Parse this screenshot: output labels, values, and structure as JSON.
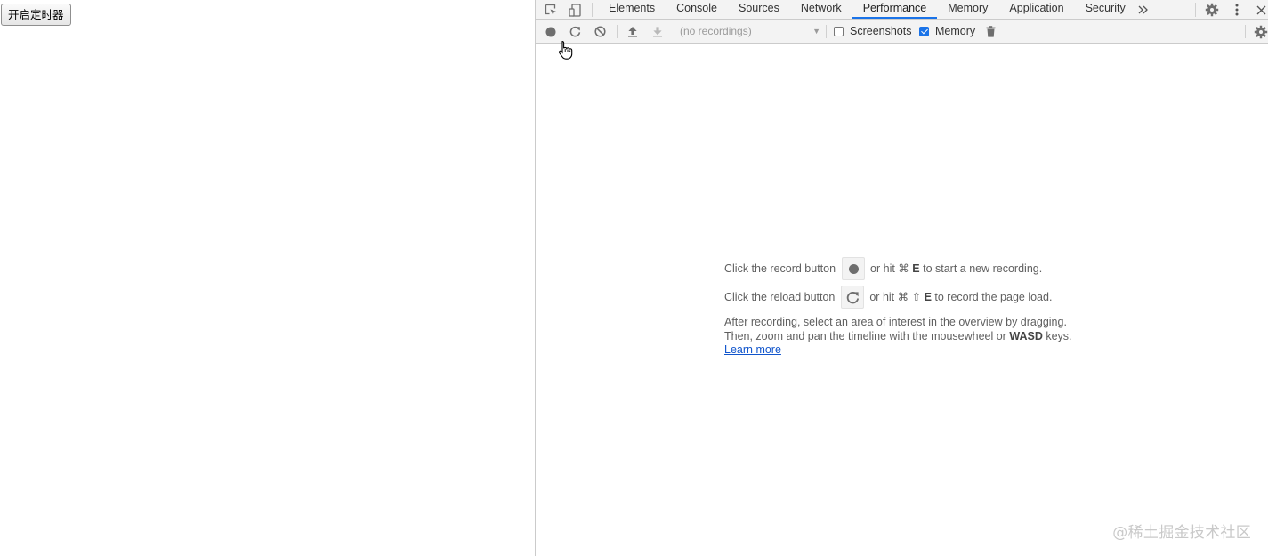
{
  "page": {
    "start_timer_button": "开启定时器"
  },
  "devtools": {
    "tabs": [
      {
        "label": "Elements",
        "active": false
      },
      {
        "label": "Console",
        "active": false
      },
      {
        "label": "Sources",
        "active": false
      },
      {
        "label": "Network",
        "active": false
      },
      {
        "label": "Performance",
        "active": true
      },
      {
        "label": "Memory",
        "active": false
      },
      {
        "label": "Application",
        "active": false
      },
      {
        "label": "Security",
        "active": false
      }
    ],
    "more_tabs_icon": "chevrons-right-icon",
    "toolbar": {
      "recordings_placeholder": "(no recordings)",
      "screenshots_label": "Screenshots",
      "screenshots_checked": false,
      "memory_label": "Memory",
      "memory_checked": true
    },
    "landing": {
      "record_prefix": "Click the record button",
      "record_suffix_a": "or hit ⌘",
      "record_key": "E",
      "record_suffix_b": "to start a new recording.",
      "reload_prefix": "Click the reload button",
      "reload_suffix_a": "or hit ⌘ ⇧",
      "reload_key": "E",
      "reload_suffix_b": "to record the page load.",
      "para_line1": "After recording, select an area of interest in the overview by dragging.",
      "para_line2_a": "Then, zoom and pan the timeline with the mousewheel or",
      "para_line2_key": "WASD",
      "para_line2_b": "keys.",
      "learn_more": "Learn more"
    }
  },
  "watermark": "@稀土掘金技术社区",
  "colors": {
    "accent": "#1a73e8",
    "link": "#1155cc",
    "toolbar_bg": "#f3f3f3"
  }
}
